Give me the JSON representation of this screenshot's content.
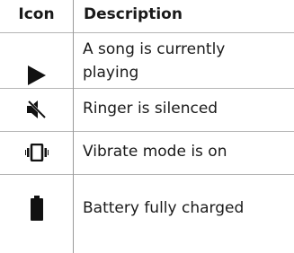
{
  "table": {
    "header": {
      "icon": "Icon",
      "description": "Description"
    },
    "rows": [
      {
        "icon": "play-icon",
        "description": "A song is currently playing"
      },
      {
        "icon": "ringer-silenced-icon",
        "description": "Ringer is silenced"
      },
      {
        "icon": "vibrate-icon",
        "description": "Vibrate mode is on"
      },
      {
        "icon": "battery-full-icon",
        "description": "Battery fully charged"
      }
    ]
  }
}
